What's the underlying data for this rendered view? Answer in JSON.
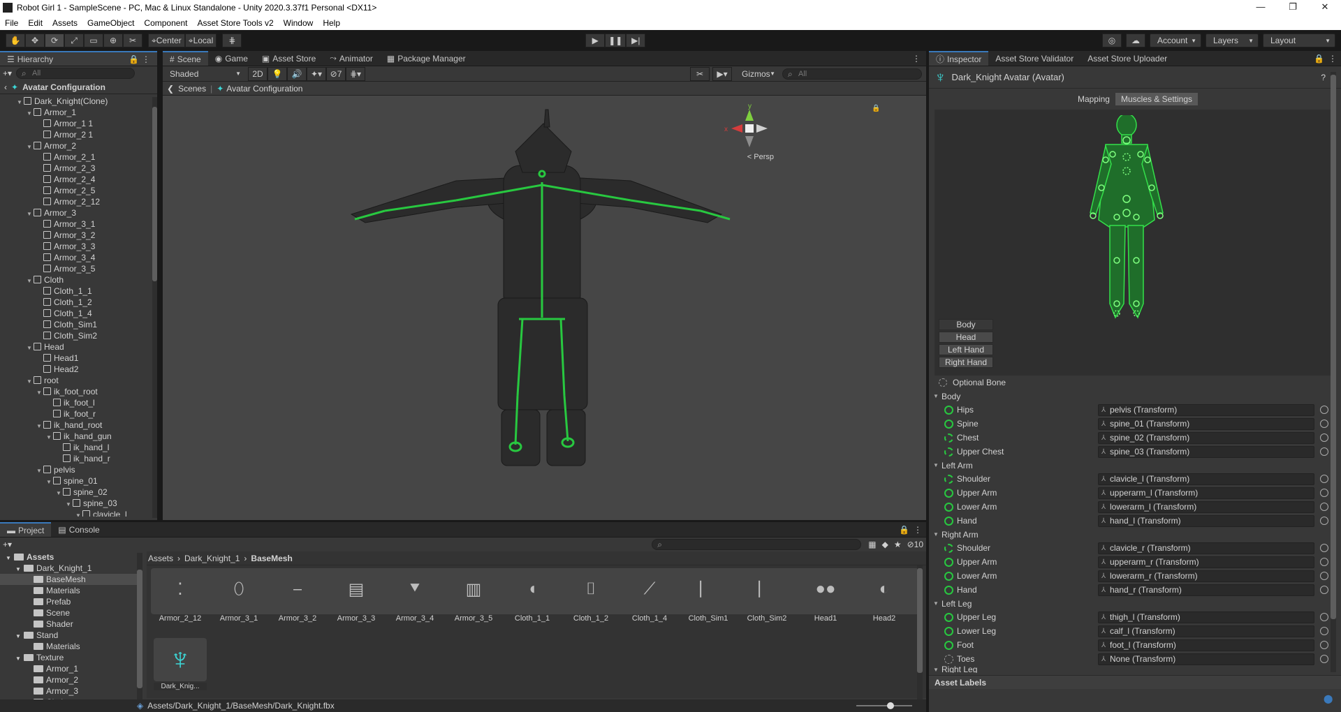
{
  "window": {
    "title": "Robot Girl 1 - SampleScene - PC, Mac & Linux Standalone - Unity 2020.3.37f1 Personal <DX11>"
  },
  "menu": [
    "File",
    "Edit",
    "Assets",
    "GameObject",
    "Component",
    "Asset Store Tools v2",
    "Window",
    "Help"
  ],
  "toolbar": {
    "pivot": "Center",
    "space": "Local",
    "account": "Account",
    "layers": "Layers",
    "layout": "Layout"
  },
  "hierarchy": {
    "tab": "Hierarchy",
    "search_placeholder": "All",
    "header": "Avatar Configuration",
    "rows": [
      {
        "label": "Dark_Knight(Clone)",
        "indent": 0,
        "expand": true
      },
      {
        "label": "Armor_1",
        "indent": 1,
        "expand": true
      },
      {
        "label": "Armor_1 1",
        "indent": 2,
        "expand": false
      },
      {
        "label": "Armor_2 1",
        "indent": 2,
        "expand": false
      },
      {
        "label": "Armor_2",
        "indent": 1,
        "expand": true
      },
      {
        "label": "Armor_2_1",
        "indent": 2,
        "expand": false
      },
      {
        "label": "Armor_2_3",
        "indent": 2,
        "expand": false
      },
      {
        "label": "Armor_2_4",
        "indent": 2,
        "expand": false
      },
      {
        "label": "Armor_2_5",
        "indent": 2,
        "expand": false
      },
      {
        "label": "Armor_2_12",
        "indent": 2,
        "expand": false
      },
      {
        "label": "Armor_3",
        "indent": 1,
        "expand": true
      },
      {
        "label": "Armor_3_1",
        "indent": 2,
        "expand": false
      },
      {
        "label": "Armor_3_2",
        "indent": 2,
        "expand": false
      },
      {
        "label": "Armor_3_3",
        "indent": 2,
        "expand": false
      },
      {
        "label": "Armor_3_4",
        "indent": 2,
        "expand": false
      },
      {
        "label": "Armor_3_5",
        "indent": 2,
        "expand": false
      },
      {
        "label": "Cloth",
        "indent": 1,
        "expand": true
      },
      {
        "label": "Cloth_1_1",
        "indent": 2,
        "expand": false
      },
      {
        "label": "Cloth_1_2",
        "indent": 2,
        "expand": false
      },
      {
        "label": "Cloth_1_4",
        "indent": 2,
        "expand": false
      },
      {
        "label": "Cloth_Sim1",
        "indent": 2,
        "expand": false
      },
      {
        "label": "Cloth_Sim2",
        "indent": 2,
        "expand": false
      },
      {
        "label": "Head",
        "indent": 1,
        "expand": true
      },
      {
        "label": "Head1",
        "indent": 2,
        "expand": false
      },
      {
        "label": "Head2",
        "indent": 2,
        "expand": false
      },
      {
        "label": "root",
        "indent": 1,
        "expand": true
      },
      {
        "label": "ik_foot_root",
        "indent": 2,
        "expand": true
      },
      {
        "label": "ik_foot_l",
        "indent": 3,
        "expand": false
      },
      {
        "label": "ik_foot_r",
        "indent": 3,
        "expand": false
      },
      {
        "label": "ik_hand_root",
        "indent": 2,
        "expand": true
      },
      {
        "label": "ik_hand_gun",
        "indent": 3,
        "expand": true
      },
      {
        "label": "ik_hand_l",
        "indent": 4,
        "expand": false
      },
      {
        "label": "ik_hand_r",
        "indent": 4,
        "expand": false
      },
      {
        "label": "pelvis",
        "indent": 2,
        "expand": true
      },
      {
        "label": "spine_01",
        "indent": 3,
        "expand": true
      },
      {
        "label": "spine_02",
        "indent": 4,
        "expand": true
      },
      {
        "label": "spine_03",
        "indent": 5,
        "expand": true
      },
      {
        "label": "clavicle_l",
        "indent": 6,
        "expand": true
      }
    ]
  },
  "scene": {
    "tabs": [
      "Scene",
      "Game",
      "Asset Store",
      "Animator",
      "Package Manager"
    ],
    "shading": "Shaded",
    "mode2d": "2D",
    "hidden_count": "7",
    "gizmos": "Gizmos",
    "search_placeholder": "All",
    "breadcrumb_scenes": "Scenes",
    "breadcrumb_current": "Avatar Configuration",
    "persp": "< Persp",
    "axis_x": "x",
    "axis_y": "y"
  },
  "inspector": {
    "tabs": [
      "Inspector",
      "Asset Store Validator",
      "Asset Store Uploader"
    ],
    "title": "Dark_Knight Avatar (Avatar)",
    "mode_tabs": [
      "Mapping",
      "Muscles & Settings"
    ],
    "body_buttons": [
      "Body",
      "Head",
      "Left Hand",
      "Right Hand"
    ],
    "optional_bone": "Optional Bone",
    "groups": [
      {
        "name": "Body",
        "bones": [
          {
            "label": "Hips",
            "value": "pelvis (Transform)",
            "ring": "solid"
          },
          {
            "label": "Spine",
            "value": "spine_01 (Transform)",
            "ring": "solid"
          },
          {
            "label": "Chest",
            "value": "spine_02 (Transform)",
            "ring": "dash"
          },
          {
            "label": "Upper Chest",
            "value": "spine_03 (Transform)",
            "ring": "dash"
          }
        ]
      },
      {
        "name": "Left Arm",
        "bones": [
          {
            "label": "Shoulder",
            "value": "clavicle_l (Transform)",
            "ring": "dash"
          },
          {
            "label": "Upper Arm",
            "value": "upperarm_l (Transform)",
            "ring": "solid"
          },
          {
            "label": "Lower Arm",
            "value": "lowerarm_l (Transform)",
            "ring": "solid"
          },
          {
            "label": "Hand",
            "value": "hand_l (Transform)",
            "ring": "solid"
          }
        ]
      },
      {
        "name": "Right Arm",
        "bones": [
          {
            "label": "Shoulder",
            "value": "clavicle_r (Transform)",
            "ring": "dash"
          },
          {
            "label": "Upper Arm",
            "value": "upperarm_r (Transform)",
            "ring": "solid"
          },
          {
            "label": "Lower Arm",
            "value": "lowerarm_r (Transform)",
            "ring": "solid"
          },
          {
            "label": "Hand",
            "value": "hand_r (Transform)",
            "ring": "solid"
          }
        ]
      },
      {
        "name": "Left Leg",
        "bones": [
          {
            "label": "Upper Leg",
            "value": "thigh_l (Transform)",
            "ring": "solid"
          },
          {
            "label": "Lower Leg",
            "value": "calf_l (Transform)",
            "ring": "solid"
          },
          {
            "label": "Foot",
            "value": "foot_l (Transform)",
            "ring": "solid"
          },
          {
            "label": "Toes",
            "value": "None (Transform)",
            "ring": "grey"
          }
        ]
      }
    ],
    "next_group": "Right Leg",
    "asset_labels": "Asset Labels"
  },
  "project": {
    "tabs": [
      "Project",
      "Console"
    ],
    "hidden_count": "10",
    "tree": [
      {
        "label": "Assets",
        "indent": 0,
        "bold": true,
        "expand": true
      },
      {
        "label": "Dark_Knight_1",
        "indent": 1,
        "expand": true
      },
      {
        "label": "BaseMesh",
        "indent": 2,
        "selected": true
      },
      {
        "label": "Materials",
        "indent": 2
      },
      {
        "label": "Prefab",
        "indent": 2
      },
      {
        "label": "Scene",
        "indent": 2
      },
      {
        "label": "Shader",
        "indent": 2
      },
      {
        "label": "Stand",
        "indent": 1,
        "expand": true
      },
      {
        "label": "Materials",
        "indent": 2
      },
      {
        "label": "Texture",
        "indent": 1,
        "expand": true
      },
      {
        "label": "Armor_1",
        "indent": 2
      },
      {
        "label": "Armor_2",
        "indent": 2
      },
      {
        "label": "Armor_3",
        "indent": 2
      },
      {
        "label": "Cloth",
        "indent": 2
      }
    ],
    "breadcrumb": [
      "Assets",
      "Dark_Knight_1",
      "BaseMesh"
    ],
    "assets": [
      "Armor_2_12",
      "Armor_3_1",
      "Armor_3_2",
      "Armor_3_3",
      "Armor_3_4",
      "Armor_3_5",
      "Cloth_1_1",
      "Cloth_1_2",
      "Cloth_1_4",
      "Cloth_Sim1",
      "Cloth_Sim2",
      "Head1",
      "Head2"
    ],
    "avatar_asset": "Dark_Knig...",
    "status_path": "Assets/Dark_Knight_1/BaseMesh/Dark_Knight.fbx"
  },
  "colors": {
    "accent": "#3a79bb",
    "bone_green": "#28c840",
    "panel": "#383838",
    "scene_bg": "#464646"
  }
}
